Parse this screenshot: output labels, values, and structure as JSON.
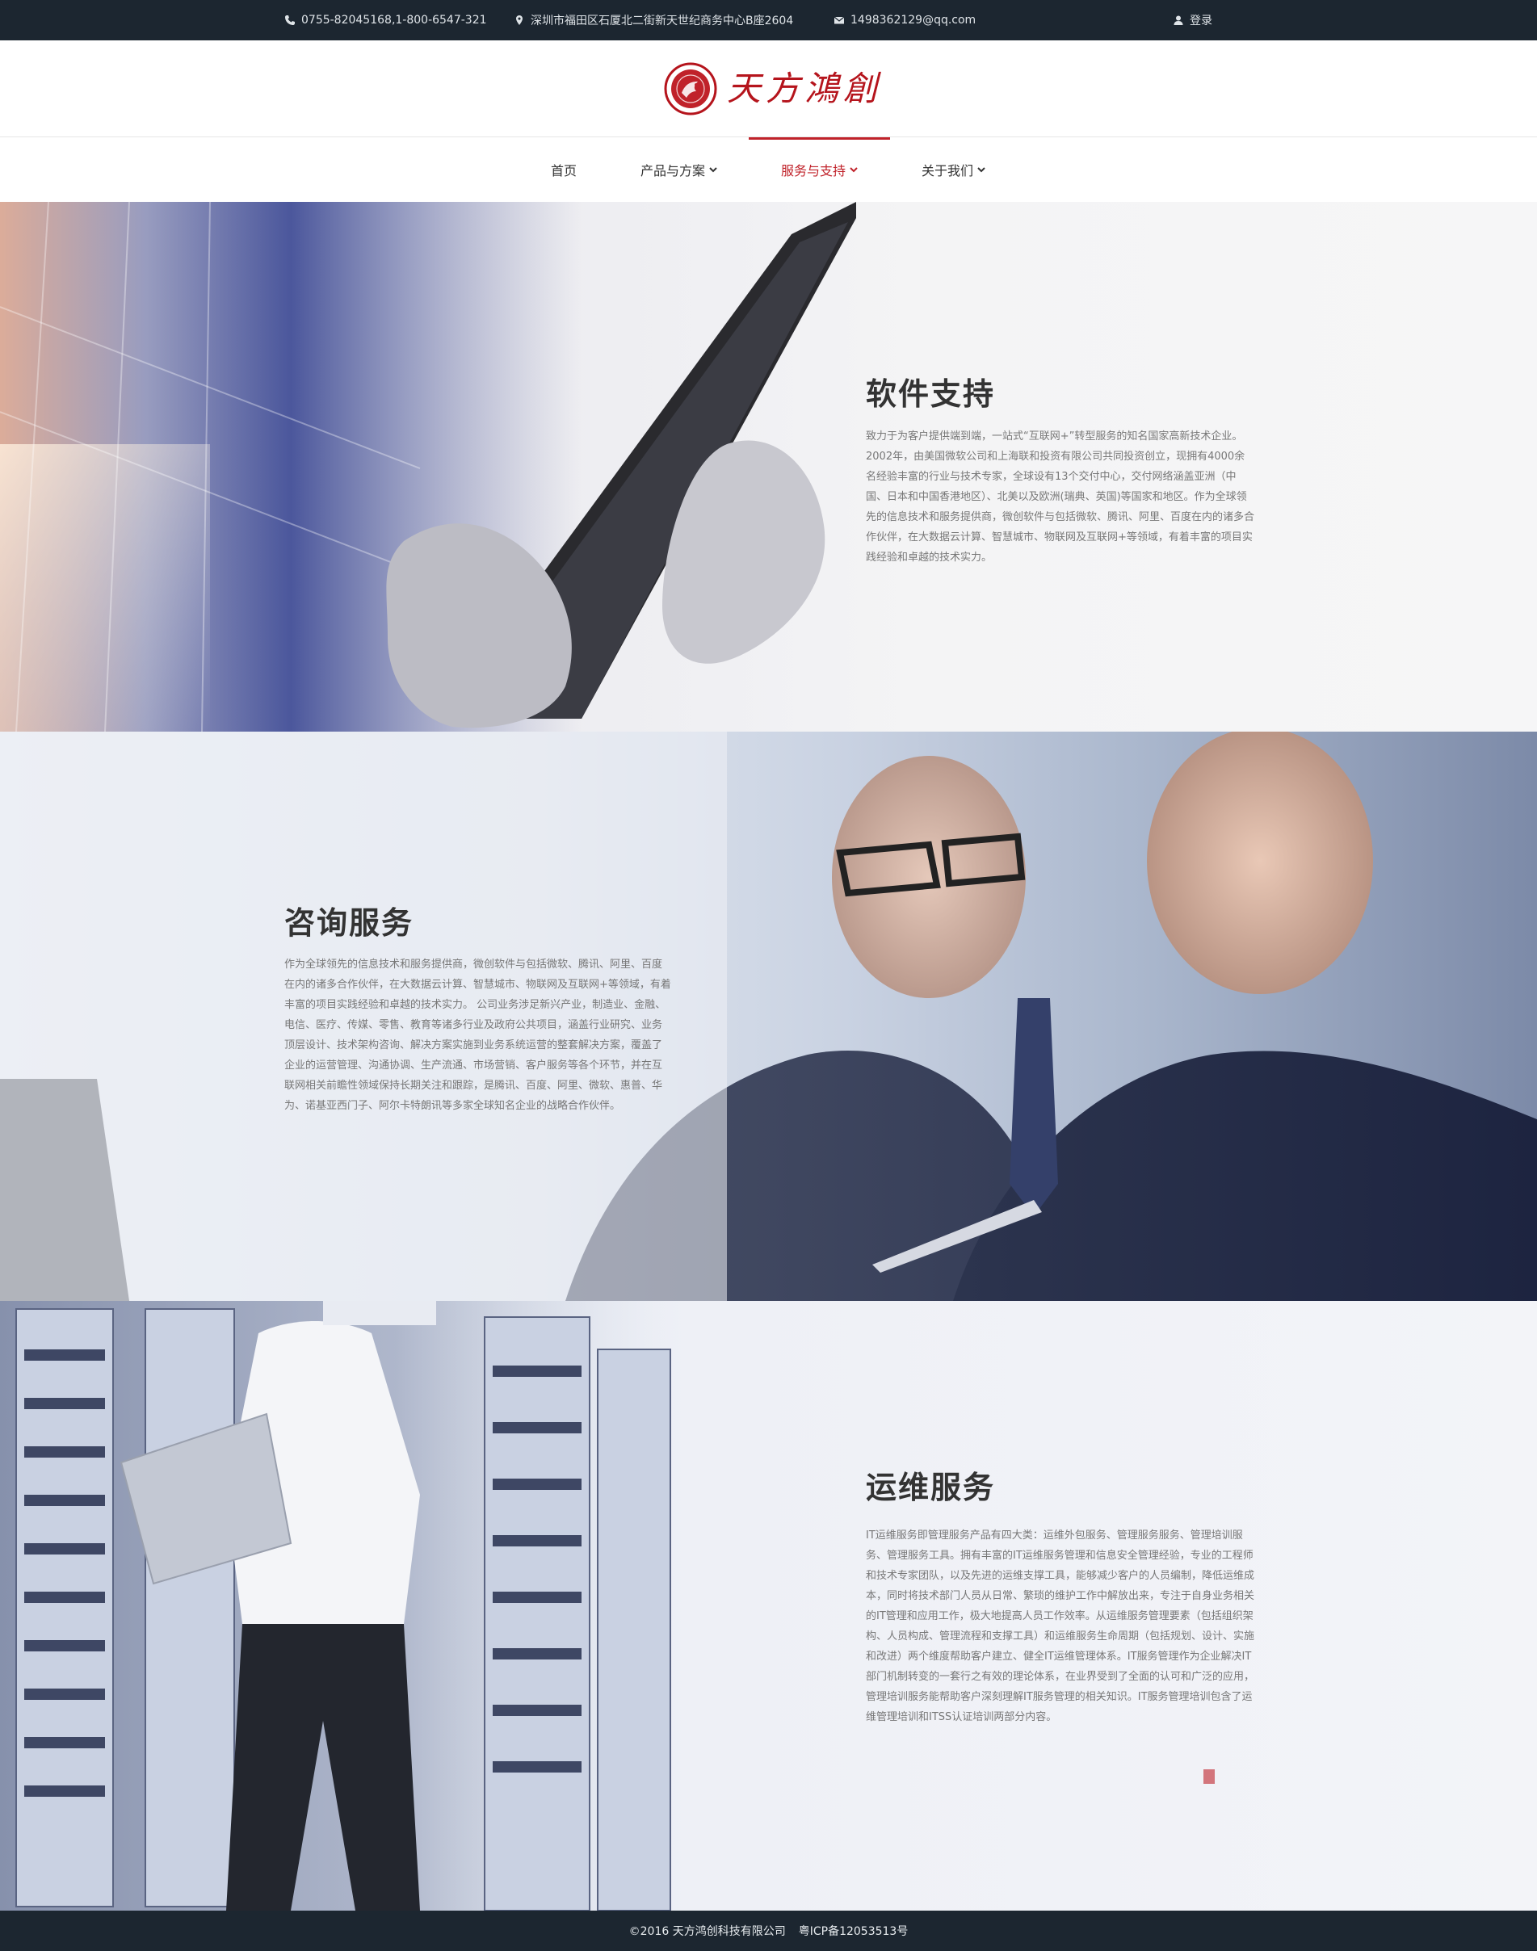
{
  "topbar": {
    "phone": "0755-82045168,1-800-6547-321",
    "address": "深圳市福田区石厦北二街新天世纪商务中心B座2604",
    "email": "1498362129@qq.com",
    "login": "登录"
  },
  "logo": {
    "text": "天方鴻創"
  },
  "nav": {
    "items": [
      {
        "label": "首页"
      },
      {
        "label": "产品与方案"
      },
      {
        "label": "服务与支持"
      },
      {
        "label": "关于我们"
      }
    ],
    "active_index": 2
  },
  "sections": [
    {
      "title": "软件支持",
      "body": "致力于为客户提供端到端，一站式“互联网+”转型服务的知名国家高新技术企业。2002年，由美国微软公司和上海联和投资有限公司共同投资创立，现拥有4000余名经验丰富的行业与技术专家，全球设有13个交付中心，交付网络涵盖亚洲（中国、日本和中国香港地区）、北美以及欧洲(瑞典、英国)等国家和地区。作为全球领先的信息技术和服务提供商，微创软件与包括微软、腾讯、阿里、百度在内的诸多合作伙伴，在大数据云计算、智慧城市、物联网及互联网+等领域，有着丰富的项目实践经验和卓越的技术实力。"
    },
    {
      "title": "咨询服务",
      "body": "作为全球领先的信息技术和服务提供商，微创软件与包括微软、腾讯、阿里、百度在内的诸多合作伙伴，在大数据云计算、智慧城市、物联网及互联网+等领域，有着丰富的项目实践经验和卓越的技术实力。 公司业务涉足新兴产业，制造业、金融、电信、医疗、传媒、零售、教育等诸多行业及政府公共项目，涵盖行业研究、业务顶层设计、技术架构咨询、解决方案实施到业务系统运营的整套解决方案，覆盖了企业的运营管理、沟通协调、生产流通、市场营销、客户服务等各个环节，并在互联网相关前瞻性领域保持长期关注和跟踪，是腾讯、百度、阿里、微软、惠普、华为、诺基亚西门子、阿尔卡特朗讯等多家全球知名企业的战略合作伙伴。"
    },
    {
      "title": "运维服务",
      "body": "IT运维服务即管理服务产品有四大类：运维外包服务、管理服务服务、管理培训服务、管理服务工具。拥有丰富的IT运维服务管理和信息安全管理经验，专业的工程师和技术专家团队，以及先进的运维支撑工具，能够减少客户的人员编制，降低运维成本，同时将技术部门人员从日常、繁琐的维护工作中解放出来，专注于自身业务相关的IT管理和应用工作，极大地提高人员工作效率。从运维服务管理要素（包括组织架构、人员构成、管理流程和支撑工具）和运维服务生命周期（包括规划、设计、实施和改进）两个维度帮助客户建立、健全IT运维管理体系。IT服务管理作为企业解决IT部门机制转变的一套行之有效的理论体系，在业界受到了全面的认可和广泛的应用，管理培训服务能帮助客户深刻理解IT服务管理的相关知识。IT服务管理培训包含了运维管理培训和ITSS认证培训两部分内容。"
    }
  ],
  "footer": {
    "copyright": "©2016 天方鸿创科技有限公司",
    "icp": "粤ICP备12053513号"
  }
}
